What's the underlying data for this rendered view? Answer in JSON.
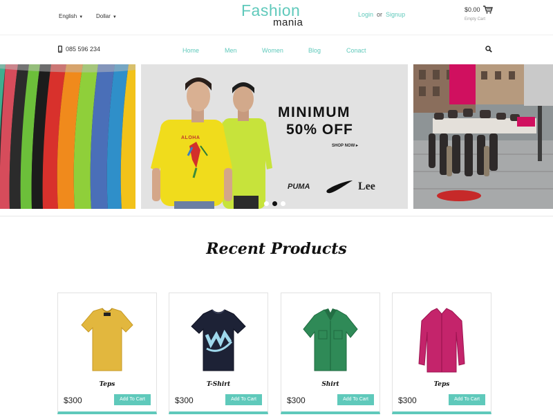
{
  "header": {
    "language": "English",
    "currency": "Dollar",
    "logo_line1": "Fashion",
    "logo_line2": "mania",
    "login": "Login",
    "or": "or",
    "signup": "Signup",
    "cart_amount": "$0.00",
    "cart_status": "Empty Cart",
    "accent_color": "#5fc9bb"
  },
  "navbar": {
    "phone": "085 596 234",
    "items": [
      "Home",
      "Men",
      "Women",
      "Blog",
      "Conact"
    ]
  },
  "banner": {
    "headline_1": "MINIMUM",
    "headline_2": "50% OFF",
    "cta": "SHOP NOW ▸",
    "shirt_print": "ALOHA",
    "brands": [
      "PUMA",
      "Nike",
      "Lee"
    ],
    "slide_count": 3,
    "active_slide": 2
  },
  "recent": {
    "title": "Recent Products",
    "products": [
      {
        "name": "Teps",
        "price": "$300",
        "button": "Add To Cart",
        "color": "#e2b73e"
      },
      {
        "name": "T-Shirt",
        "price": "$300",
        "button": "Add To Cart",
        "color": "#1d2236"
      },
      {
        "name": "Shirt",
        "price": "$300",
        "button": "Add To Cart",
        "color": "#2f8a57"
      },
      {
        "name": "Teps",
        "price": "$300",
        "button": "Add To Cart",
        "color": "#c4246b"
      }
    ]
  }
}
